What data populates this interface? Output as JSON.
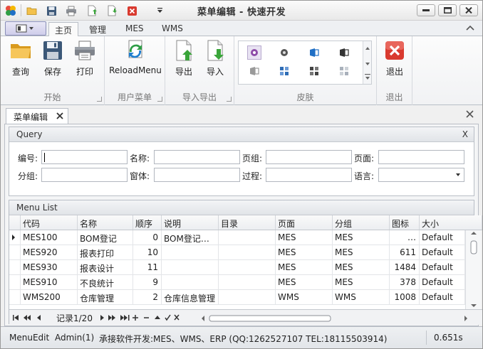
{
  "window": {
    "title": "菜单编辑 - 快速开发"
  },
  "ribbon": {
    "tabs": [
      "主页",
      "管理",
      "MES",
      "WMS"
    ],
    "active_tab": "主页",
    "groups": {
      "start": {
        "label": "开始",
        "buttons": [
          "查询",
          "保存",
          "打印"
        ]
      },
      "user_menu": {
        "label": "用户菜单",
        "buttons": [
          "ReloadMenu"
        ]
      },
      "import_export": {
        "label": "导入导出",
        "buttons": [
          "导出",
          "导入"
        ]
      },
      "skin": {
        "label": "皮肤"
      },
      "exit": {
        "label": "退出",
        "buttons": [
          "退出"
        ]
      }
    }
  },
  "doc_tab": {
    "label": "菜单编辑"
  },
  "query": {
    "title": "Query",
    "close": "X",
    "fields": [
      {
        "label": "编号:",
        "value": ""
      },
      {
        "label": "名称:",
        "value": ""
      },
      {
        "label": "页组:",
        "value": ""
      },
      {
        "label": "页面:",
        "value": ""
      },
      {
        "label": "分组:",
        "value": ""
      },
      {
        "label": "窗体:",
        "value": ""
      },
      {
        "label": "过程:",
        "value": ""
      },
      {
        "label": "语言:",
        "value": ""
      }
    ]
  },
  "menu_list": {
    "title": "Menu List",
    "columns": [
      "代码",
      "名称",
      "顺序",
      "说明",
      "目录",
      "页面",
      "分组",
      "图标",
      "大小"
    ],
    "rows": [
      [
        "MES100",
        "BOM登记",
        "0",
        "BOM登记…",
        "",
        "MES",
        "MES",
        "…",
        "Default"
      ],
      [
        "MES920",
        "报表打印",
        "10",
        "",
        "",
        "MES",
        "MES",
        "611",
        "Default"
      ],
      [
        "MES930",
        "报表设计",
        "11",
        "",
        "",
        "MES",
        "MES",
        "1484",
        "Default"
      ],
      [
        "MES910",
        "不良统计",
        "9",
        "",
        "",
        "MES",
        "MES",
        "378",
        "Default"
      ],
      [
        "WMS200",
        "仓库管理",
        "2",
        "仓库信息管理",
        "",
        "WMS",
        "WMS",
        "1008",
        "Default"
      ]
    ],
    "navigator": {
      "record_text": "记录1/20"
    }
  },
  "status": {
    "items": [
      "MenuEdit",
      "Admin(1)",
      "承接软件开发:MES、WMS、ERP  (QQ:1262527107  TEL:18115503914)",
      "0.651s"
    ]
  },
  "colors": {
    "accent_blue": "#1f6fc5",
    "exit_red": "#d93a2f",
    "green": "#3aa53a"
  }
}
